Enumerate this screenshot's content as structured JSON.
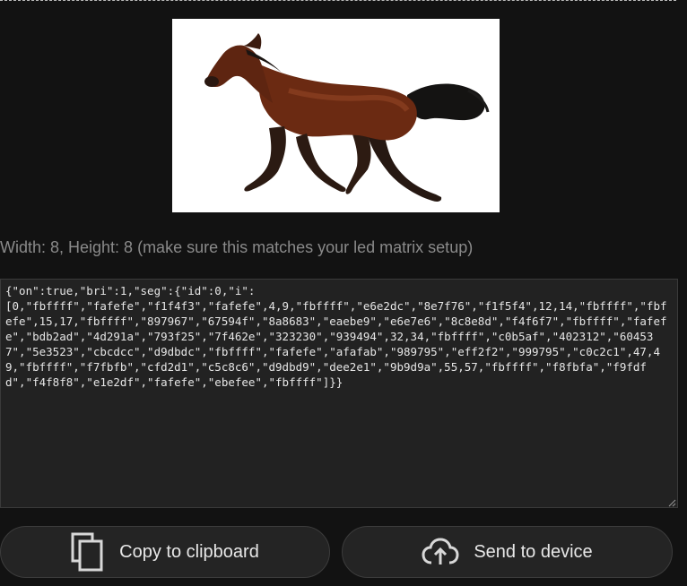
{
  "matrix": {
    "dimensions_text": "Width: 8, Height: 8 (make sure this matches your led matrix setup)"
  },
  "output": {
    "json_text": "{\"on\":true,\"bri\":1,\"seg\":{\"id\":0,\"i\":\n[0,\"fbffff\",\"fafefe\",\"f1f4f3\",\"fafefe\",4,9,\"fbffff\",\"e6e2dc\",\"8e7f76\",\"f1f5f4\",12,14,\"fbffff\",\"fbfefe\",15,17,\"fbffff\",\"897967\",\"67594f\",\"8a8683\",\"eaebe9\",\"e6e7e6\",\"8c8e8d\",\"f4f6f7\",\"fbffff\",\"fafefe\",\"bdb2ad\",\"4d291a\",\"793f25\",\"7f462e\",\"323230\",\"939494\",32,34,\"fbffff\",\"c0b5af\",\"402312\",\"604537\",\"5e3523\",\"cbcdcc\",\"d9dbdc\",\"fbffff\",\"fafefe\",\"afafab\",\"989795\",\"eff2f2\",\"999795\",\"c0c2c1\",47,49,\"fbffff\",\"f7fbfb\",\"cfd2d1\",\"c5c8c6\",\"d9dbd9\",\"dee2e1\",\"9b9d9a\",55,57,\"fbffff\",\"f8fbfa\",\"f9fdfd\",\"f4f8f8\",\"e1e2df\",\"fafefe\",\"ebefee\",\"fbffff\"]}}"
  },
  "buttons": {
    "copy_label": "Copy to clipboard",
    "send_label": "Send to device"
  },
  "icons": {
    "copy": "copy-icon",
    "send": "cloud-upload-icon"
  },
  "colors": {
    "background": "#121212",
    "panel": "#222222",
    "text_muted": "#8a8a8a",
    "text": "#e6e6e6"
  }
}
